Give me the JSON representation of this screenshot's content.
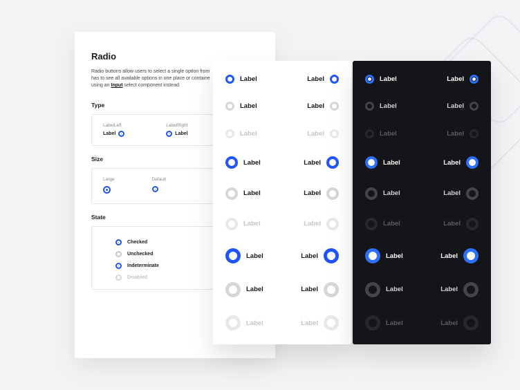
{
  "doc": {
    "title": "Radio",
    "desc_1": "Radio buttons allow users to select a single option from",
    "desc_2": "has to see all available options in one place or containe",
    "desc_3_prefix": "using an ",
    "desc_3_link": "Input",
    "desc_3_suffix": " select component instead.",
    "type": {
      "heading": "Type",
      "left_title": "LabelLeft",
      "left_label": "Label",
      "right_title": "LabelRight",
      "right_label": "Label"
    },
    "size": {
      "heading": "Size",
      "large_title": "Large",
      "default_title": "Default"
    },
    "state": {
      "heading": "State",
      "checked": "Checked",
      "unchecked": "Unchecked",
      "indeterminate": "Indeterminate",
      "disabled": "Disabled"
    }
  },
  "swatch_label": "Label",
  "grid_rows": [
    {
      "size": "sm",
      "state": "checked"
    },
    {
      "size": "sm",
      "state": "unchecked"
    },
    {
      "size": "sm",
      "state": "disabled"
    },
    {
      "size": "lg",
      "state": "checked"
    },
    {
      "size": "lg",
      "state": "unchecked"
    },
    {
      "size": "lg",
      "state": "disabled"
    },
    {
      "size": "xl",
      "state": "checked"
    },
    {
      "size": "xl",
      "state": "unchecked"
    },
    {
      "size": "xl",
      "state": "disabled"
    }
  ]
}
